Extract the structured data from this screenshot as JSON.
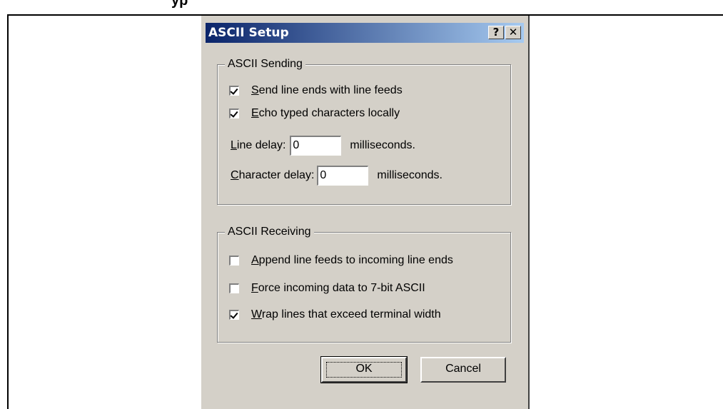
{
  "background": {
    "partial_heading": "yp"
  },
  "dialog": {
    "title": "ASCII Setup",
    "help_button": "?",
    "close_button": "✕",
    "sending": {
      "title": "ASCII Sending",
      "send_line_ends": {
        "mnemonic": "S",
        "rest": "end line ends with line feeds",
        "checked": true
      },
      "echo_typed": {
        "mnemonic": "E",
        "rest": "cho typed characters locally",
        "checked": true
      },
      "line_delay": {
        "mnemonic": "L",
        "rest": "ine delay:",
        "value": "0",
        "unit": "milliseconds."
      },
      "char_delay": {
        "mnemonic": "C",
        "rest": "haracter delay:",
        "value": "0",
        "unit": "milliseconds."
      }
    },
    "receiving": {
      "title": "ASCII Receiving",
      "append_line_feeds": {
        "mnemonic": "A",
        "rest": "ppend line feeds to incoming line ends",
        "checked": false
      },
      "force_7bit": {
        "mnemonic": "F",
        "rest": "orce incoming data to 7-bit ASCII",
        "checked": false
      },
      "wrap_lines": {
        "mnemonic": "W",
        "rest": "rap lines that exceed terminal width",
        "checked": true
      }
    },
    "ok_label": "OK",
    "cancel_label": "Cancel"
  },
  "colors": {
    "dialog_face": "#d4d0c8",
    "titlebar_start": "#0a246a",
    "titlebar_end": "#a6caf0"
  }
}
